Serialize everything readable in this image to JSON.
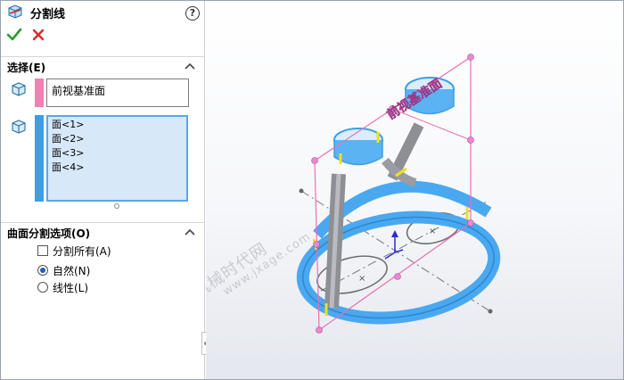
{
  "feature": {
    "title": "分割线",
    "help_symbol": "?",
    "ok_icon": "checkmark-icon",
    "cancel_icon": "close-icon"
  },
  "selection": {
    "header": "选择(E)",
    "plane_value": "前视基准面",
    "faces": [
      "面<1>",
      "面<2>",
      "面<3>",
      "面<4>"
    ],
    "colors": {
      "plane": "#f47fb2",
      "faces": "#3d9ee6"
    }
  },
  "options": {
    "header": "曲面分割选项(O)",
    "split_all": {
      "label": "分割所有(A)",
      "checked": false
    },
    "natural": {
      "label": "自然(N)",
      "selected": true
    },
    "linear": {
      "label": "线性(L)",
      "selected": false
    }
  },
  "viewport": {
    "plane_label": "前视基准面",
    "watermark_cn": "机械时代网",
    "watermark_url": "www.jxage.com"
  }
}
